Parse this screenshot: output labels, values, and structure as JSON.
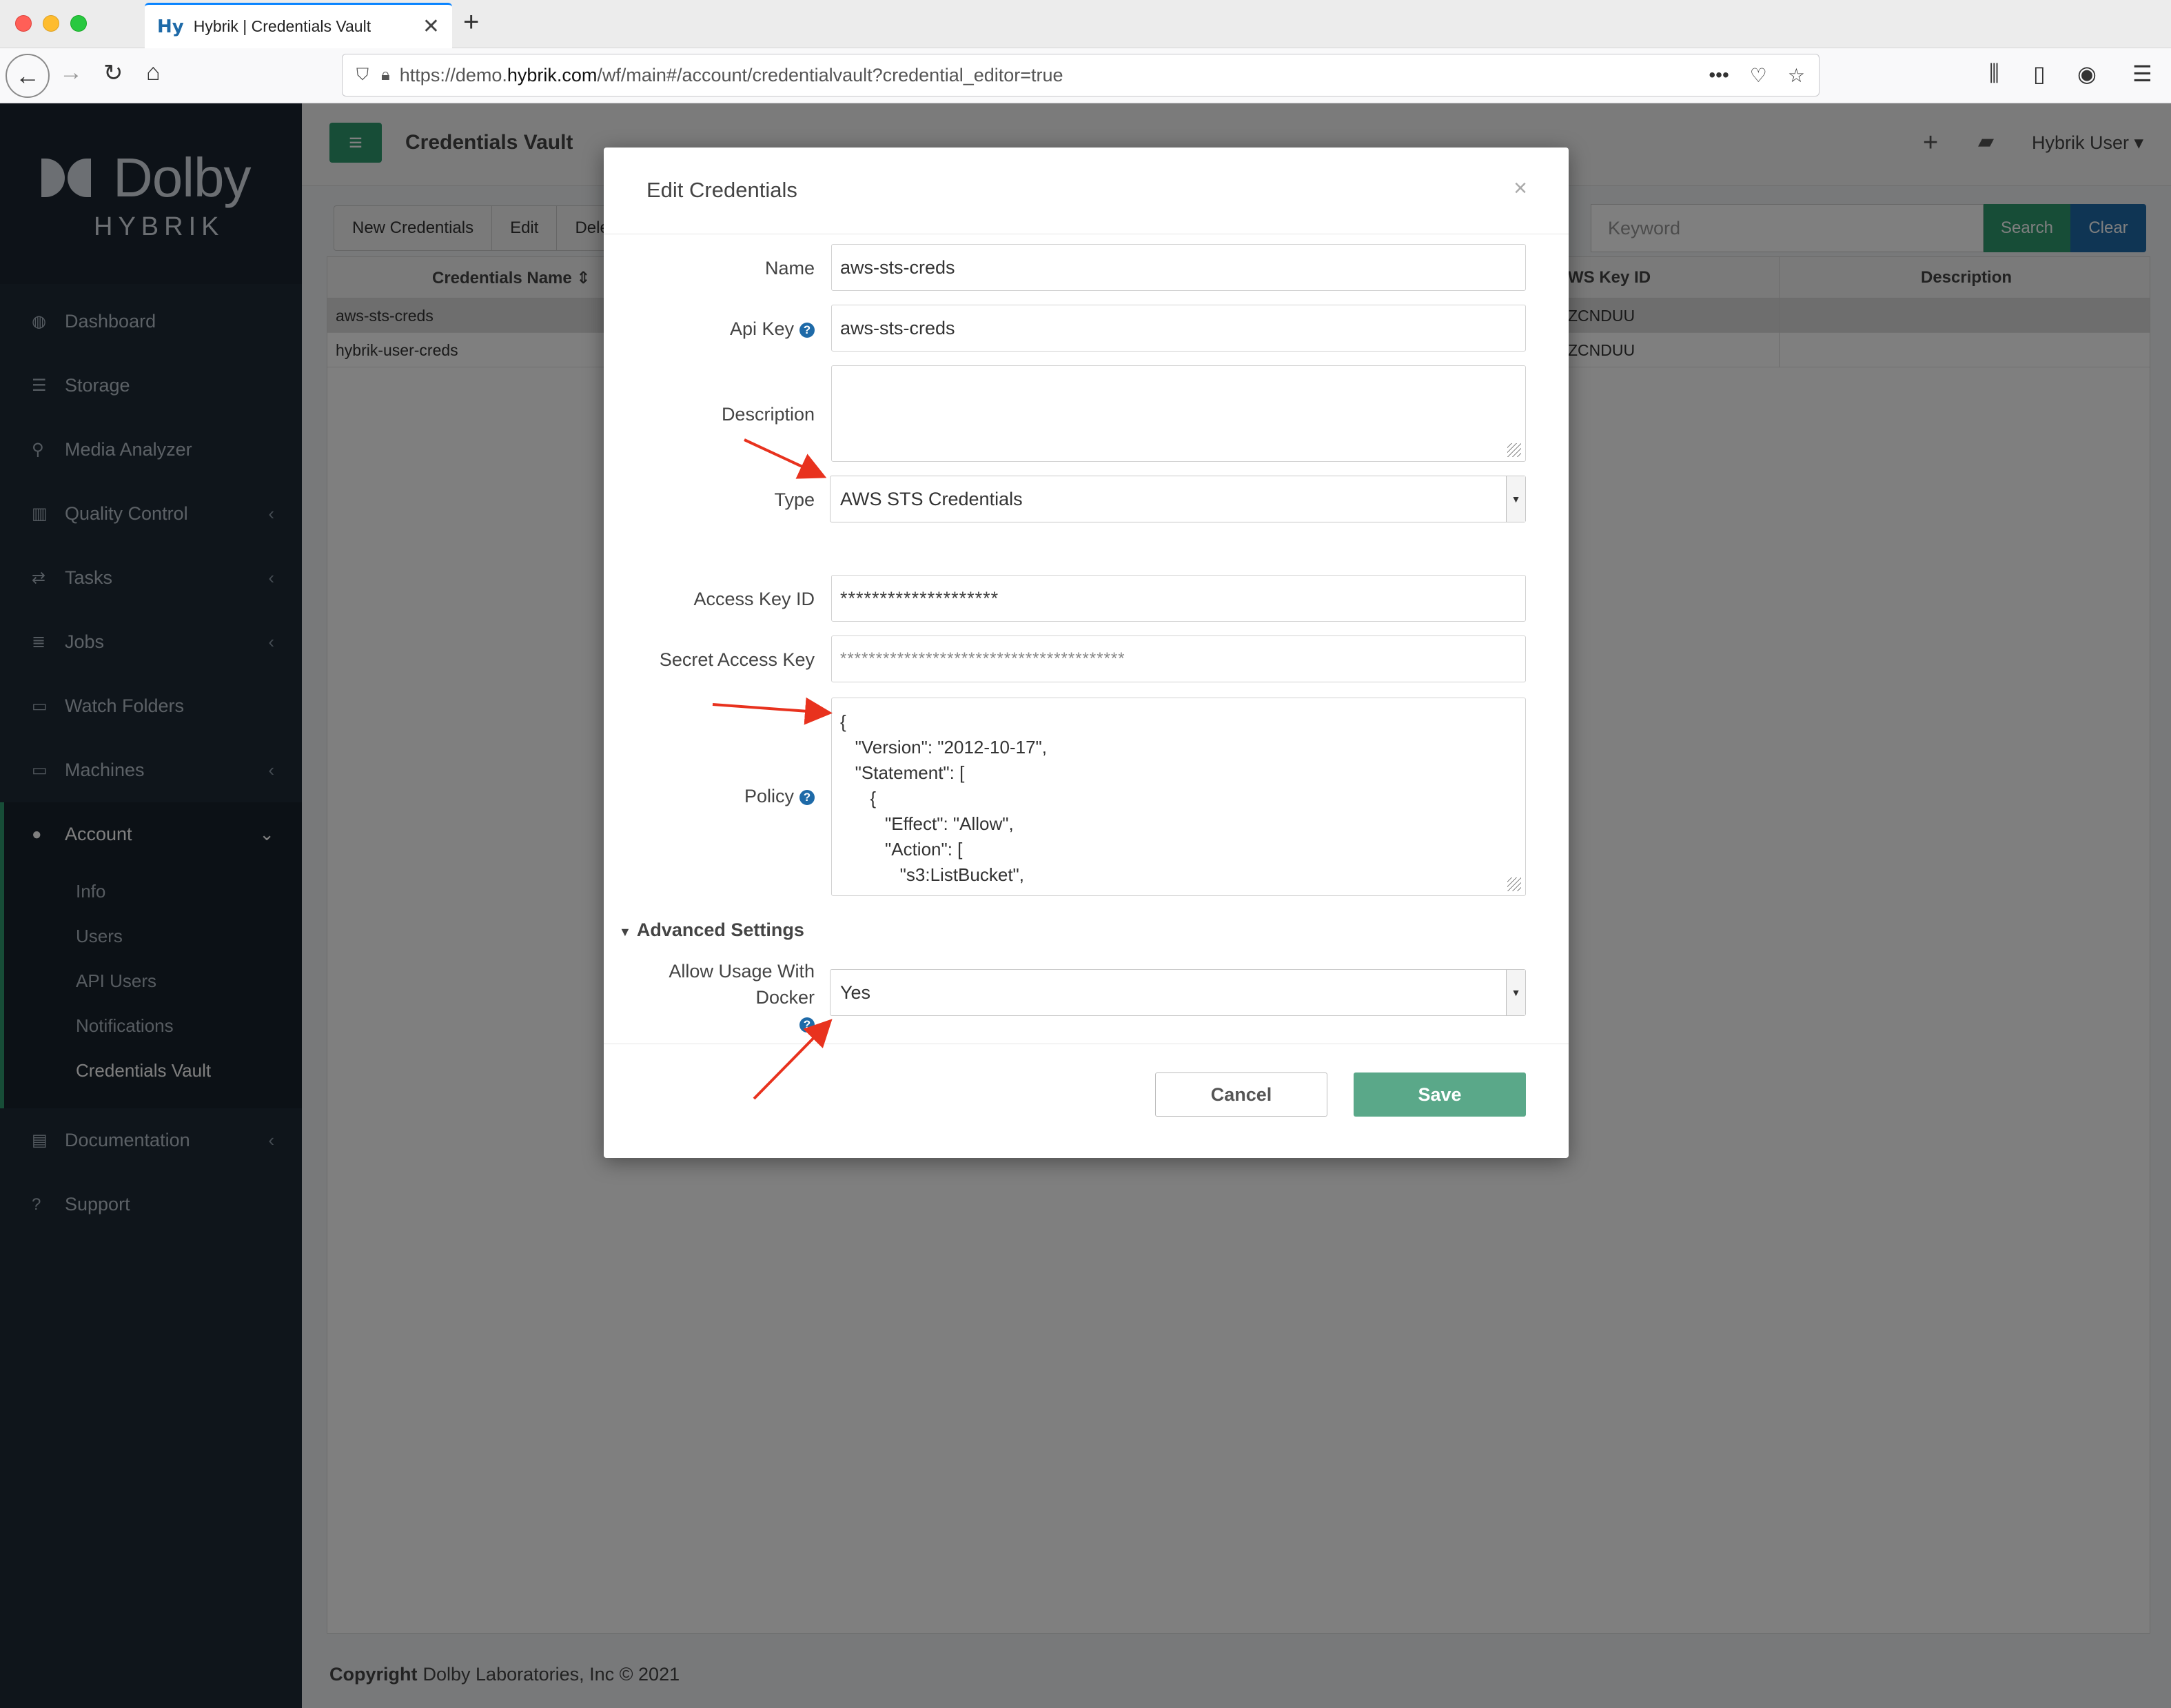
{
  "browser": {
    "tab_favicon": "Hy",
    "tab_title": "Hybrik | Credentials Vault",
    "new_tab": "+",
    "url_prefix": "https://demo.",
    "url_domain": "hybrik.com",
    "url_path": "/wf/main#/account/credentialvault?credential_editor=true"
  },
  "sidebar": {
    "logo_brand": "Dolby",
    "logo_sub": "HYBRIK",
    "items": [
      {
        "label": "Dashboard",
        "icon": "dashboard-icon"
      },
      {
        "label": "Storage",
        "icon": "database-icon"
      },
      {
        "label": "Media Analyzer",
        "icon": "search-icon"
      },
      {
        "label": "Quality Control",
        "icon": "bar-chart-icon"
      },
      {
        "label": "Tasks",
        "icon": "exchange-icon"
      },
      {
        "label": "Jobs",
        "icon": "list-icon"
      },
      {
        "label": "Watch Folders",
        "icon": "folder-icon"
      },
      {
        "label": "Machines",
        "icon": "monitor-icon"
      },
      {
        "label": "Account",
        "icon": "user-icon"
      },
      {
        "label": "Documentation",
        "icon": "book-icon"
      },
      {
        "label": "Support",
        "icon": "question-icon"
      }
    ],
    "account_sub": [
      "Info",
      "Users",
      "API Users",
      "Notifications",
      "Credentials Vault"
    ]
  },
  "main": {
    "page_title": "Credentials Vault",
    "user_menu": "Hybrik User",
    "toolbar": {
      "new": "New Credentials",
      "edit": "Edit",
      "delete": "Dele"
    },
    "search": {
      "placeholder": "Keyword",
      "search_label": "Search",
      "clear_label": "Clear"
    },
    "table": {
      "headers": {
        "name": "Credentials Name",
        "key": "WS Key ID",
        "description": "Description"
      },
      "rows": [
        {
          "name": "aws-sts-creds",
          "key": "ZCNDUU"
        },
        {
          "name": "hybrik-user-creds",
          "key": "ZCNDUU"
        }
      ]
    },
    "footer": {
      "bold": "Copyright",
      "text": "Dolby Laboratories, Inc © 2021"
    }
  },
  "modal": {
    "title": "Edit Credentials",
    "close": "×",
    "name_label": "Name",
    "name_value": "aws-sts-creds",
    "api_key_label": "Api Key",
    "api_key_value": "aws-sts-creds",
    "description_label": "Description",
    "type_label": "Type",
    "type_value": "AWS STS Credentials",
    "access_key_label": "Access Key ID",
    "access_key_value": "********************",
    "secret_key_label": "Secret Access Key",
    "secret_key_value": "****************************************",
    "policy_label": "Policy",
    "policy_lines": [
      "{",
      "   \"Version\": \"2012-10-17\",",
      "   \"Statement\": [",
      "      {",
      "         \"Effect\": \"Allow\",",
      "         \"Action\": [",
      "            \"s3:ListBucket\","
    ],
    "advanced_label": "Advanced Settings",
    "docker_label_line1": "Allow Usage With",
    "docker_label_line2": "Docker",
    "docker_value": "Yes",
    "help_glyph": "?",
    "cancel_label": "Cancel",
    "save_label": "Save"
  },
  "colors": {
    "accent_green": "#2e9a6f",
    "accent_blue": "#1e6aa8",
    "annotation_red": "#e8321e",
    "sidebar_bg": "#1e2a36"
  }
}
